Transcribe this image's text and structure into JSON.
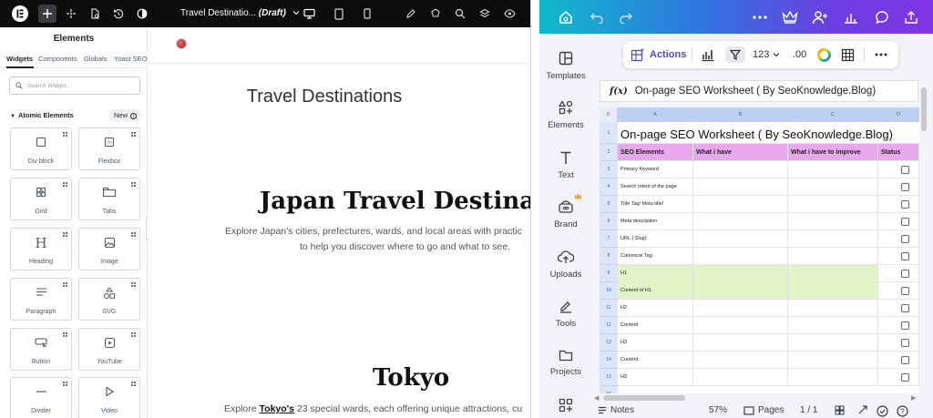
{
  "builder": {
    "doc_title": "Travel Destinatio...",
    "doc_status": "(Draft)",
    "panel": {
      "title": "Elements",
      "tabs": [
        "Widgets",
        "Components",
        "Globals",
        "Yoast SEO"
      ],
      "search_placeholder": "Search Widget...",
      "section_title": "Atomic Elements",
      "new_badge": "New",
      "widgets": [
        "Div block",
        "Flexbox",
        "Grid",
        "Tabs",
        "Heading",
        "Image",
        "Paragraph",
        "SVG",
        "Button",
        "YouTube",
        "Divider",
        "Video"
      ]
    },
    "canvas": {
      "page_heading": "Travel Destinations",
      "section_heading": "Japan Travel Destinatio",
      "intro_line1": "Explore Japan's cities, prefectures, wards, and local areas with practic",
      "intro_line2": "to help you discover where to go and what to see.",
      "tokyo_heading": "Tokyo",
      "tokyo_pre": "Explore ",
      "tokyo_link": "Tokyo's",
      "tokyo_post": " 23 special wards, each offering unique attractions, cu"
    }
  },
  "sheet": {
    "sidebar": [
      "Templates",
      "Elements",
      "Text",
      "Brand",
      "Uploads",
      "Tools",
      "Projects"
    ],
    "toolbar": {
      "actions_label": "Actions",
      "number_format": "123",
      "decimals": ".00"
    },
    "formula_bar": {
      "fx": "f(x)",
      "value": "On-page SEO Worksheet ( By SeoKnowledge.Blog)"
    },
    "grid": {
      "corner": "0",
      "columns": [
        "A",
        "B",
        "C",
        "D"
      ],
      "row_numbers": [
        "1",
        "2",
        "3",
        "4",
        "5",
        "6",
        "7",
        "8",
        "9",
        "10",
        "11",
        "12",
        "13",
        "14",
        "15",
        "16"
      ],
      "title_cell": "On-page SEO Worksheet (  By SeoKnowledge.Blog)",
      "headers": [
        "SEO Elements",
        "What i have",
        "What i have to improve",
        "Status"
      ],
      "rows": [
        {
          "label": "Primary Keyword",
          "highlight": false
        },
        {
          "label": "Search Intent of the page",
          "highlight": false
        },
        {
          "label": "Title Tag/ Meta title!",
          "highlight": false
        },
        {
          "label": "Meta description",
          "highlight": false
        },
        {
          "label": "URL ( Slug)",
          "highlight": false
        },
        {
          "label": "Canonical Tag",
          "highlight": false
        },
        {
          "label": "H1",
          "highlight": true
        },
        {
          "label": "Content of H1",
          "highlight": true
        },
        {
          "label": "H2",
          "highlight": false
        },
        {
          "label": "Content",
          "highlight": false
        },
        {
          "label": "H3",
          "highlight": false
        },
        {
          "label": "Content",
          "highlight": false
        },
        {
          "label": "H3",
          "highlight": false
        }
      ]
    },
    "bottom": {
      "notes": "Notes",
      "zoom": "57%",
      "pages": "Pages",
      "page_count": "1 / 1"
    },
    "colors": {
      "header_fill": "#e9a7ee",
      "highlight_fill": "#e2f3c8",
      "accent": "#4a4ad6"
    }
  }
}
